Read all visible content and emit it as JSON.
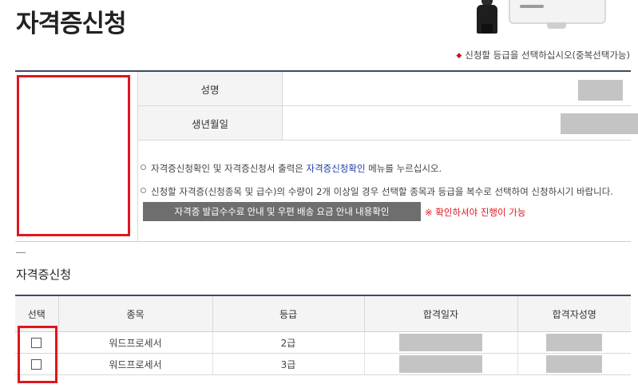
{
  "page": {
    "title": "자격증신청"
  },
  "notice_top": "신청할 등급을 선택하십시오(중복선택가능)",
  "applicant": {
    "name_label": "성명",
    "birth_label": "생년월일"
  },
  "notes": {
    "line1_prefix": "자격증신청확인 및 자격증신청서 출력은 ",
    "line1_link": "자격증신청확인",
    "line1_suffix": " 메뉴를 누르십시오.",
    "line2": "신청할 자격증(신청종목 및 급수)의 수량이 2개 이상일 경우 선택할 종목과 등급을 복수로 선택하여 신청하시기 바랍니다."
  },
  "fee_button": "자격증 발급수수료 안내 및 우편 배송 요금 안내 내용확인",
  "fee_warning": "※ 확인하셔야 진행이 가능",
  "section": {
    "title": "자격증신청"
  },
  "cert_table": {
    "headers": [
      "선택",
      "종목",
      "등급",
      "합격일자",
      "합격자성명"
    ],
    "rows": [
      {
        "subject": "워드프로세서",
        "grade": "2급"
      },
      {
        "subject": "워드프로세서",
        "grade": "3급"
      }
    ]
  },
  "colors": {
    "accent_red": "#e0161d",
    "header_line": "#3f4a60",
    "link": "#1f3ea8"
  },
  "icons": [
    "bullet-diamond-icon",
    "circle-bullet-icon",
    "checkbox-icon"
  ]
}
